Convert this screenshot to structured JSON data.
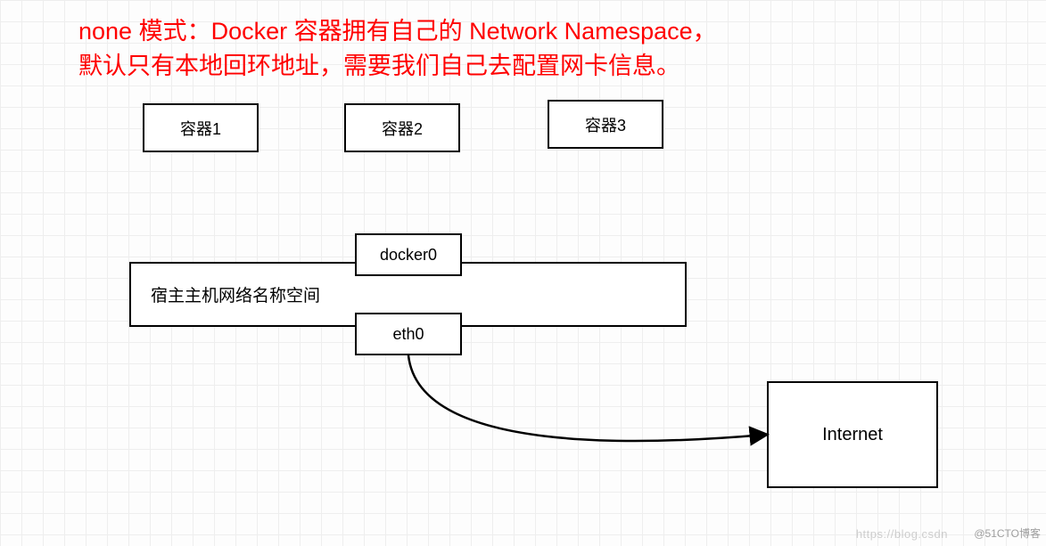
{
  "title": {
    "line1": "none 模式：Docker 容器拥有自己的 Network Namespace，",
    "line2": "默认只有本地回环地址，需要我们自己去配置网卡信息。"
  },
  "containers": [
    {
      "label": "容器1"
    },
    {
      "label": "容器2"
    },
    {
      "label": "容器3"
    }
  ],
  "host": {
    "label": "宿主主机网络名称空间"
  },
  "interfaces": {
    "top": "docker0",
    "bottom": "eth0"
  },
  "internet": {
    "label": "Internet"
  },
  "watermarks": {
    "csdn": "https://blog.csdn",
    "cto": "@51CTO博客"
  }
}
